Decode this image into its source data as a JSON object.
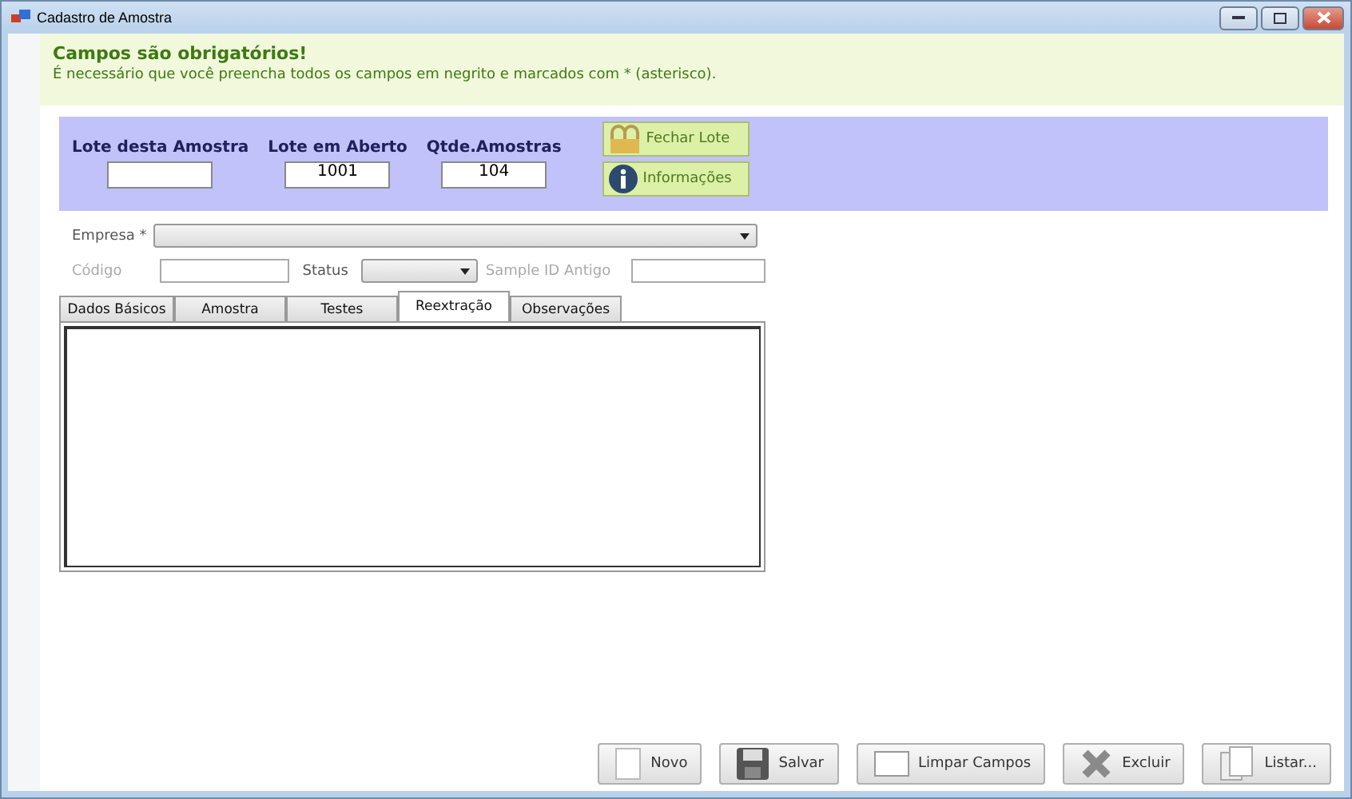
{
  "window": {
    "title": "Cadastro de Amostra"
  },
  "notice": {
    "title": "Campos são obrigatórios!",
    "text": "É necessário que você preencha todos os campos em negrito e marcados com * (asterisco)."
  },
  "lot_panel": {
    "fields": [
      {
        "label": "Lote desta Amostra"
      },
      {
        "label": "Lote em Aberto",
        "value": "1001"
      },
      {
        "label": "Qtde.Amostras",
        "value": "104"
      }
    ],
    "buttons": [
      {
        "label": "Fechar Lote",
        "kind": "lock"
      },
      {
        "label": "Informações",
        "kind": "info"
      }
    ]
  },
  "empresa": {
    "label": "Empresa *",
    "disabled": false
  },
  "codigo": {
    "label": "Código",
    "disabled": true
  },
  "status": {
    "label": "Status",
    "disabled": false
  },
  "sample_id": {
    "label": "Sample ID Antigo",
    "disabled": true
  },
  "tabs": [
    {
      "label": "Dados Básicos",
      "selected": false
    },
    {
      "label": "Amostra",
      "selected": false
    },
    {
      "label": "Testes",
      "selected": false
    },
    {
      "label": "Reextração",
      "selected": true
    },
    {
      "label": "Observações",
      "selected": false
    }
  ],
  "actions": [
    {
      "label": "Novo",
      "kind": "blank"
    },
    {
      "label": "Salvar",
      "kind": "save"
    },
    {
      "label": "Limpar Campos",
      "kind": "clear"
    },
    {
      "label": "Excluir",
      "kind": "delete"
    },
    {
      "label": "Listar...",
      "kind": "list"
    }
  ]
}
